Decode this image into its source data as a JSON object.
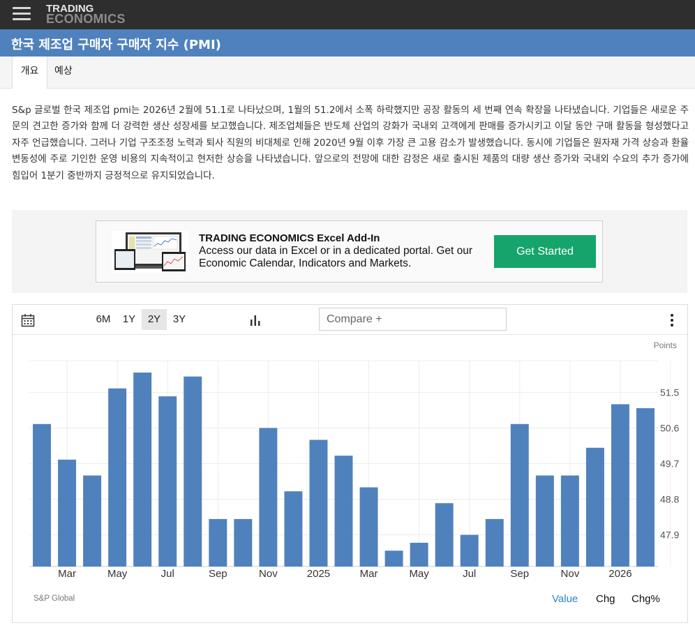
{
  "header": {
    "logo_line1": "TRADING",
    "logo_line2": "ECONOMICS"
  },
  "page_title": "한국 제조업 구매자 구매자 지수 (PMI)",
  "tabs": [
    {
      "label": "개요",
      "active": true
    },
    {
      "label": "예상",
      "active": false
    }
  ],
  "summary": "S&p 글로벌 한국 제조업 pmi는 2026년 2월에 51.1로 나타났으며, 1월의 51.2에서 소폭 하락했지만 공장 활동의 세 번째 연속 확장을 나타냈습니다. 기업들은 새로운 주문의 견고한 증가와 함께 더 강력한 생산 성장세를 보고했습니다. 제조업체들은 반도체 산업의 강화가 국내외 고객에게 판매를 증가시키고 이달 동안 구매 활동을 형성했다고 자주 언급했습니다. 그러나 기업 구조조정 노력과 퇴사 직원의 비대체로 인해 2020년 9월 이후 가장 큰 고용 감소가 발생했습니다. 동시에 기업들은 원자재 가격 상승과 환율 변동성에 주로 기인한 운영 비용의 지속적이고 현저한 상승을 나타냈습니다. 앞으로의 전망에 대한 감정은 새로 출시된 제품의 대량 생산 증가와 국내외 수요의 추가 증가에 힘입어 1분기 중반까지 긍정적으로 유지되었습니다.",
  "promo": {
    "title": "TRADING ECONOMICS Excel Add-In",
    "description": "Access our data in Excel or in a dedicated portal. Get our Economic Calendar, Indicators and Markets.",
    "button_label": "Get Started",
    "button_color": "#15a56a"
  },
  "toolbar": {
    "ranges": [
      "6M",
      "1Y",
      "2Y",
      "3Y"
    ],
    "selected_range": "2Y",
    "compare_placeholder": "Compare +"
  },
  "chart_data": {
    "type": "bar",
    "unit_label": "Points",
    "bar_color": "#4f81bd",
    "categories": [
      "2024-02",
      "2024-03",
      "2024-04",
      "2024-05",
      "2024-06",
      "2024-07",
      "2024-08",
      "2024-09",
      "2024-10",
      "2024-11",
      "2024-12",
      "2025-01",
      "2025-02",
      "2025-03",
      "2025-04",
      "2025-05",
      "2025-06",
      "2025-07",
      "2025-08",
      "2025-09",
      "2025-10",
      "2025-11",
      "2025-12",
      "2026-01",
      "2026-02"
    ],
    "values": [
      50.7,
      49.8,
      49.4,
      51.6,
      52.0,
      51.4,
      51.9,
      48.3,
      48.3,
      50.6,
      49.0,
      50.3,
      49.9,
      49.1,
      47.5,
      47.7,
      48.7,
      47.9,
      48.3,
      50.7,
      49.4,
      49.4,
      50.1,
      51.2,
      51.1
    ],
    "x_tick_labels": [
      {
        "index": 1,
        "label": "Mar"
      },
      {
        "index": 3,
        "label": "May"
      },
      {
        "index": 5,
        "label": "Jul"
      },
      {
        "index": 7,
        "label": "Sep"
      },
      {
        "index": 9,
        "label": "Nov"
      },
      {
        "index": 11,
        "label": "2025"
      },
      {
        "index": 13,
        "label": "Mar"
      },
      {
        "index": 15,
        "label": "May"
      },
      {
        "index": 17,
        "label": "Jul"
      },
      {
        "index": 19,
        "label": "Sep"
      },
      {
        "index": 21,
        "label": "Nov"
      },
      {
        "index": 23,
        "label": "2026"
      }
    ],
    "y_ticks": [
      47.9,
      48.8,
      49.7,
      50.6,
      51.5
    ],
    "ylim": [
      47.1,
      52.3
    ],
    "y_axis_position": "right",
    "grid": true,
    "source": "S&P Global"
  },
  "value_buttons": [
    {
      "label": "Value",
      "active": true
    },
    {
      "label": "Chg",
      "active": false
    },
    {
      "label": "Chg%",
      "active": false
    }
  ]
}
